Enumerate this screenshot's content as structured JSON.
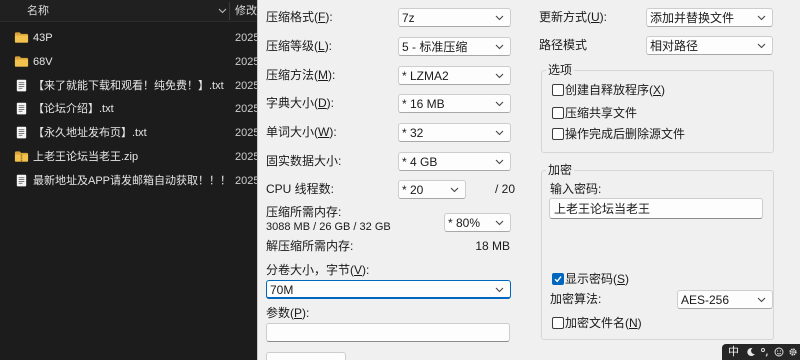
{
  "colors": {
    "accent": "#0067c0",
    "folder": "#f2c14e",
    "explorer_bg": "#1c1c1c",
    "dialog_bg": "#f0f0f0"
  },
  "explorer": {
    "header": {
      "name": "名称",
      "modified": "修改"
    },
    "rows": [
      {
        "icon": "folder-icon",
        "name": "43P",
        "date": "2025"
      },
      {
        "icon": "folder-icon",
        "name": "68V",
        "date": "2025"
      },
      {
        "icon": "text-file-icon",
        "name": "【来了就能下载和观看！纯免费！】.txt",
        "date": "2025"
      },
      {
        "icon": "text-file-icon",
        "name": "【论坛介绍】.txt",
        "date": "2025"
      },
      {
        "icon": "text-file-icon",
        "name": "【永久地址发布页】.txt",
        "date": "2025"
      },
      {
        "icon": "zip-folder-icon",
        "name": "上老王论坛当老王.zip",
        "date": "2025"
      },
      {
        "icon": "text-file-icon",
        "name": "最新地址及APP请发邮箱自动获取！！！....",
        "date": "2025"
      }
    ]
  },
  "dialog": {
    "format": {
      "label": "压缩格式(F):",
      "value": "7z"
    },
    "level": {
      "label": "压缩等级(L):",
      "value": "5 - 标准压缩"
    },
    "method": {
      "label": "压缩方法(M):",
      "value": "* LZMA2"
    },
    "dictionary": {
      "label": "字典大小(D):",
      "value": "* 16 MB"
    },
    "word_size": {
      "label": "单词大小(W):",
      "value": "* 32"
    },
    "solid_block": {
      "label": "固实数据大小:",
      "value": "* 4 GB"
    },
    "threads": {
      "label": "CPU 线程数:",
      "value": "* 20",
      "max": "/ 20"
    },
    "compress_memory": {
      "label": "压缩所需内存:",
      "usage": "3088 MB / 26 GB / 32 GB",
      "limit": "* 80%"
    },
    "decompress_memory": {
      "label": "解压缩所需内存:",
      "value": "18 MB"
    },
    "volume_size": {
      "label": "分卷大小，字节(V):",
      "value": "70M"
    },
    "parameters": {
      "label": "参数(P):",
      "value": ""
    },
    "update_mode": {
      "label": "更新方式(U):",
      "value": "添加并替换文件"
    },
    "path_mode": {
      "label": "路径模式",
      "value": "相对路径"
    },
    "options": {
      "title": "选项",
      "items": [
        {
          "label": "创建自释放程序(X)",
          "checked": false
        },
        {
          "label": "压缩共享文件",
          "checked": false
        },
        {
          "label": "操作完成后删除源文件",
          "checked": false
        }
      ]
    },
    "encryption": {
      "title": "加密",
      "password_label": "输入密码:",
      "password": "上老王论坛当老王",
      "show_password": {
        "label": "显示密码(S)",
        "checked": true
      },
      "method_label": "加密算法:",
      "method": "AES-256",
      "encrypt_names": {
        "label": "加密文件名(N)",
        "checked": false
      }
    }
  },
  "ime_toolbar": {
    "mode": "中",
    "icons": [
      "half-width-icon",
      "punctuation-icon",
      "emoji-icon",
      "settings-icon"
    ]
  }
}
